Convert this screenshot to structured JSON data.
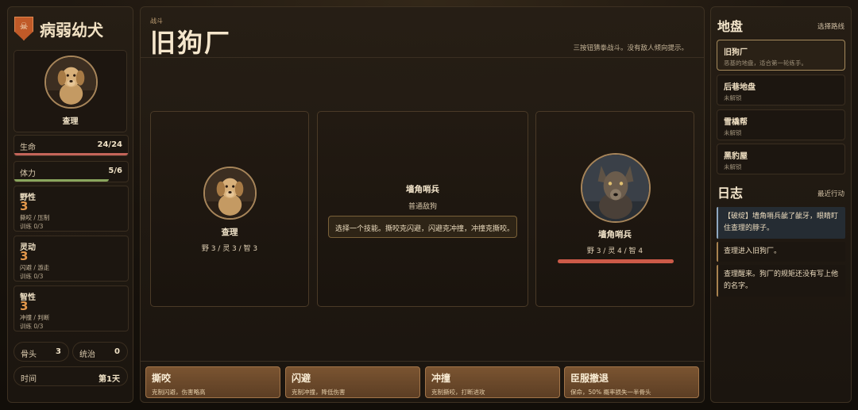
{
  "character": {
    "name": "病弱幼犬",
    "emblem_glyph": "☠",
    "portrait_name": "查理"
  },
  "stats": {
    "hp": {
      "label": "生命",
      "value": "24/24",
      "fraction": 1.0,
      "color": "#c5655a"
    },
    "stamina": {
      "label": "体力",
      "value": "5/6",
      "fraction": 0.83,
      "color": "#8aa65e"
    }
  },
  "attributes": [
    {
      "name": "野性",
      "value": "3",
      "desc": "撕咬 / 压制",
      "train": "训练 0/3"
    },
    {
      "name": "灵动",
      "value": "3",
      "desc": "闪避 / 游走",
      "train": "训练 0/3"
    },
    {
      "name": "智性",
      "value": "3",
      "desc": "冲撞 / 判断",
      "train": "训练 0/3"
    }
  ],
  "resources": {
    "bones": {
      "label": "骨头",
      "value": "3"
    },
    "rule": {
      "label": "统治",
      "value": "0"
    },
    "time": {
      "label": "时间",
      "value": "第1天"
    }
  },
  "battle": {
    "eyebrow": "战斗",
    "title": "旧狗厂",
    "hint": "三按钮猜拳战斗。没有敌人倾向提示。",
    "player": {
      "name": "查理",
      "stats": "野 3 / 灵 3 / 智 3"
    },
    "info": {
      "title": "墙角哨兵",
      "subtitle": "普通敌狗",
      "message": "选择一个技能。撕咬克闪避，闪避克冲撞，冲撞克撕咬。"
    },
    "enemy": {
      "name": "墙角哨兵",
      "stats": "野 3 / 灵 4 / 智 4",
      "hp_fraction": 1.0
    }
  },
  "actions": [
    {
      "title": "撕咬",
      "desc": "克制闪避，伤害略高"
    },
    {
      "title": "闪避",
      "desc": "克制冲撞，降低伤害"
    },
    {
      "title": "冲撞",
      "desc": "克制撕咬，打断进攻"
    },
    {
      "title": "臣服撤退",
      "desc": "保命，50% 概率损失一半骨头"
    }
  ],
  "territory": {
    "title": "地盘",
    "link": "选择路线",
    "routes": [
      {
        "name": "旧狗厂",
        "sub": "恶基的地盘，适合第一轮练手。",
        "selected": true
      },
      {
        "name": "后巷地盘",
        "sub": "未解锁",
        "selected": false
      },
      {
        "name": "雪橇帮",
        "sub": "未解锁",
        "selected": false
      },
      {
        "name": "黑豹屋",
        "sub": "未解锁",
        "selected": false
      }
    ]
  },
  "journal": {
    "title": "日志",
    "link": "最近行动",
    "entries": [
      "【破绽】墙角哨兵龇了龇牙，眼睛盯住查理的脖子。",
      "查理进入旧狗厂。",
      "查理醒来。狗厂的规矩还没有写上他的名字。"
    ]
  }
}
